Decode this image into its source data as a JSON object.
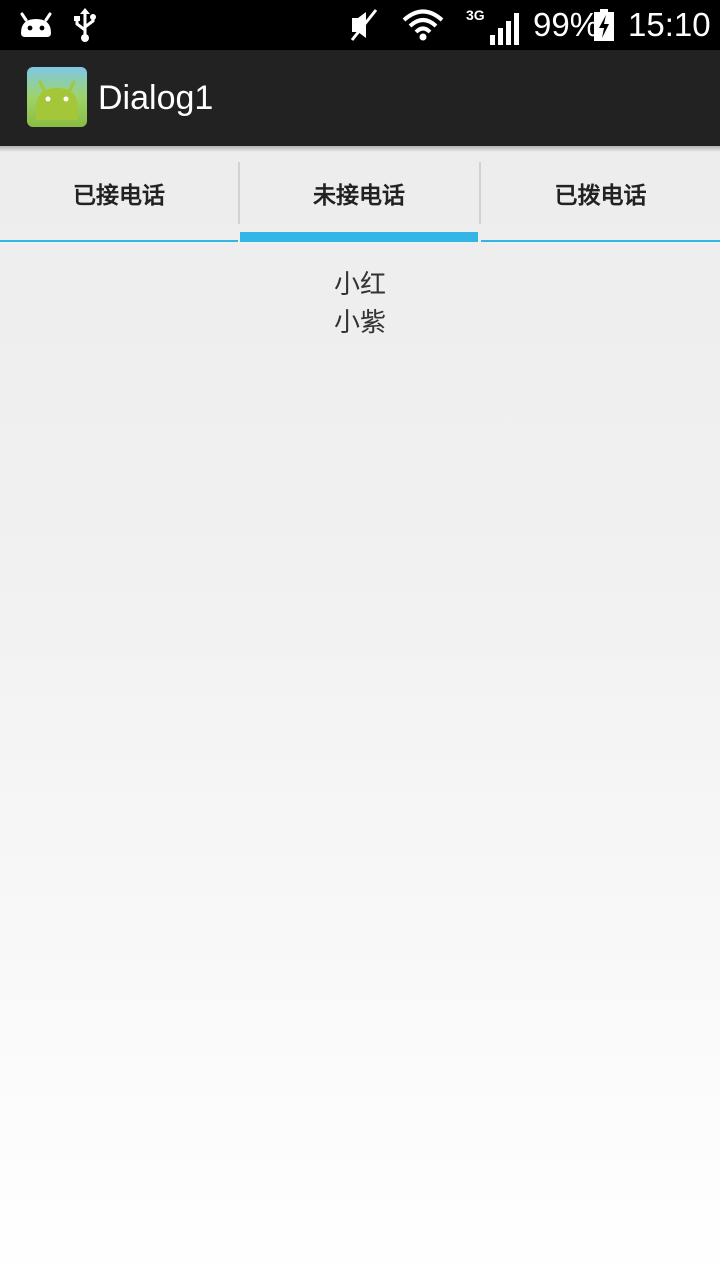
{
  "status_bar": {
    "icons_left": [
      "android-notification-icon",
      "usb-icon"
    ],
    "icons_right": [
      "mute-icon",
      "wifi-icon",
      "signal-3g-icon",
      "battery-charging-icon"
    ],
    "network": "3G",
    "battery": "99%",
    "time": "15:10"
  },
  "action_bar": {
    "app_icon": "android-app-icon",
    "title": "Dialog1"
  },
  "tabs": [
    {
      "label": "已接电话",
      "selected": false
    },
    {
      "label": "未接电话",
      "selected": true
    },
    {
      "label": "已拨电话",
      "selected": false
    }
  ],
  "list": {
    "items": [
      "小红",
      "小紫"
    ]
  },
  "colors": {
    "accent": "#33b5e5",
    "action_bar_bg": "#222222",
    "status_bar_bg": "#000000",
    "app_icon_green": "#a4c639"
  }
}
